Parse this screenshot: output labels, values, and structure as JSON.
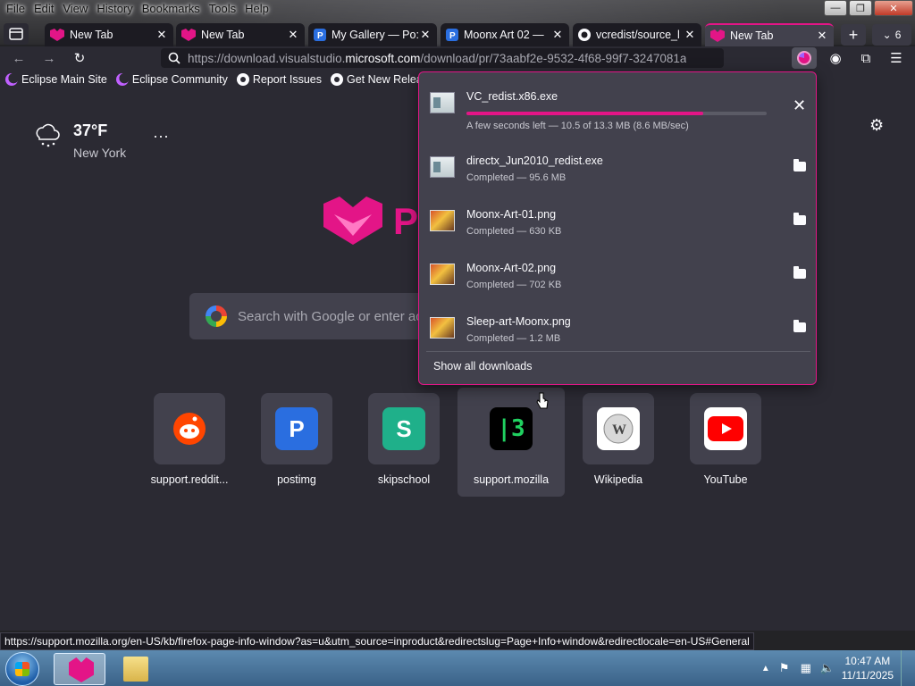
{
  "menu": [
    "File",
    "Edit",
    "View",
    "History",
    "Bookmarks",
    "Tools",
    "Help"
  ],
  "window_buttons": {
    "minimize": "—",
    "maximize": "❐",
    "close": "✕"
  },
  "tabs": [
    {
      "title": "New Tab",
      "icon": "fox-icon",
      "active": false
    },
    {
      "title": "New Tab",
      "icon": "fox-icon",
      "active": false
    },
    {
      "title": "My Gallery — Po:",
      "icon": "postimg-icon",
      "active": false
    },
    {
      "title": "Moonx Art 02 —",
      "icon": "postimg-icon",
      "active": false
    },
    {
      "title": "vcredist/source_l",
      "icon": "github-icon",
      "active": false
    },
    {
      "title": "New Tab",
      "icon": "fox-icon",
      "active": true
    }
  ],
  "tab_count": "6",
  "url": {
    "prefix": "https://download.visualstudio.",
    "domain": "microsoft.com",
    "suffix": "/download/pr/73aabf2e-9532-4f68-99f7-3247081a"
  },
  "bookmarks": [
    {
      "label": "Eclipse Main Site",
      "icon": "eclipse"
    },
    {
      "label": "Eclipse Community",
      "icon": "eclipse"
    },
    {
      "label": "Report Issues",
      "icon": "gh"
    },
    {
      "label": "Get New Releases",
      "icon": "gh"
    }
  ],
  "weather": {
    "temp": "37°F",
    "city": "New York",
    "more": "···"
  },
  "logo_letter": "P",
  "search": {
    "placeholder": "Search with Google or enter ac"
  },
  "top_sites": [
    {
      "label": "support.reddit...",
      "icon": "reddit-icon",
      "bg": "#42414d"
    },
    {
      "label": "postimg",
      "icon": "postimg-icon",
      "bg": "#2a6ee0"
    },
    {
      "label": "skipschool",
      "icon": "skipschool-icon",
      "bg": "#1fb08a"
    },
    {
      "label": "support.mozilla",
      "icon": "mozilla-icon",
      "bg": "#000000"
    },
    {
      "label": "Wikipedia",
      "icon": "wikipedia-icon",
      "bg": "#ffffff"
    },
    {
      "label": "YouTube",
      "icon": "youtube-icon",
      "bg": "#ffffff"
    }
  ],
  "downloads": {
    "items": [
      {
        "name": "VC_redist.x86.exe",
        "status": "A few seconds left — 10.5 of 13.3 MB (8.6 MB/sec)",
        "type": "exe",
        "in_progress": true,
        "progress": 0.79
      },
      {
        "name": "directx_Jun2010_redist.exe",
        "status": "Completed — 95.6 MB",
        "type": "exe",
        "in_progress": false
      },
      {
        "name": "Moonx-Art-01.png",
        "status": "Completed — 630 KB",
        "type": "png",
        "in_progress": false
      },
      {
        "name": "Moonx-Art-02.png",
        "status": "Completed — 702 KB",
        "type": "png",
        "in_progress": false
      },
      {
        "name": "Sleep-art-Moonx.png",
        "status": "Completed — 1.2 MB",
        "type": "png",
        "in_progress": false
      }
    ],
    "show_all": "Show all downloads"
  },
  "status_url": "https://support.mozilla.org/en-US/kb/firefox-page-info-window?as=u&utm_source=inproduct&redirectslug=Page+Info+window&redirectlocale=en-US#General",
  "clock": {
    "time": "10:47 AM",
    "date": "11/11/2025"
  },
  "colors": {
    "accent": "#e31587",
    "panel": "#42414d",
    "page": "#2b2a33"
  }
}
